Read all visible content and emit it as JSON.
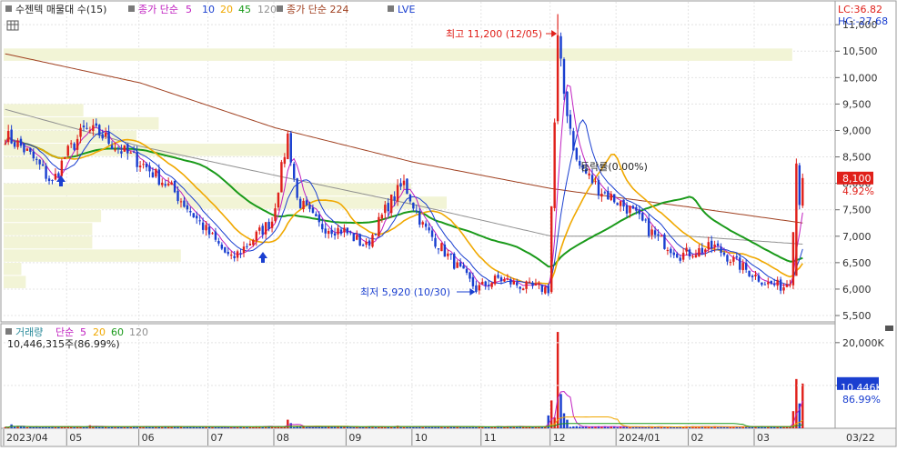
{
  "price_legend": {
    "indicator": "수젠텍 매물대 수(15)",
    "ma_label": "종가 단순",
    "ma_periods": [
      "5",
      "10",
      "20",
      "45",
      "120"
    ],
    "ma224_label": "종가 단순 224",
    "lve_label": "LVE"
  },
  "right_labels": {
    "lc": "LC:36.82",
    "hc": "HC:-27.68",
    "current_price": "8,100",
    "current_pct": "4.92%",
    "current_volume": "10,446K",
    "volume_pct": "86.99%",
    "volume_tick": "20,000K"
  },
  "annotations": {
    "high": "최고 11,200 (12/05)",
    "low": "최저 5,920 (10/30)",
    "rate": "등락률(0.00%)"
  },
  "volume_legend": {
    "title": "거래량",
    "ma_label": "단순",
    "ma_periods": [
      "5",
      "20",
      "60",
      "120"
    ],
    "summary": "10,446,315주(86.99%)"
  },
  "colors": {
    "up": "#e0201a",
    "down": "#1a3fd0",
    "ma5": "#c020c0",
    "ma10": "#1a3fd0",
    "ma20": "#f0a800",
    "ma45": "#1a9a1a",
    "ma120": "#909090",
    "ma224": "#a04020",
    "profile": "#f2f4d6"
  },
  "chart_data": [
    {
      "type": "candlestick",
      "y_ticks": [
        5500,
        6000,
        6500,
        7000,
        7500,
        8000,
        8500,
        9000,
        9500,
        10000,
        10500,
        11000
      ],
      "ylim": [
        5380,
        11450
      ],
      "x_tick_labels": [
        "2023/04",
        "05",
        "06",
        "07",
        "08",
        "09",
        "10",
        "11",
        "12",
        "2024/01",
        "02",
        "03",
        "03/22"
      ],
      "grid": true,
      "anchors": [
        {
          "d": "2023-04-03",
          "p": 8900
        },
        {
          "d": "2023-04-10",
          "p": 8700
        },
        {
          "d": "2023-04-17",
          "p": 8400
        },
        {
          "d": "2023-04-24",
          "p": 8000
        },
        {
          "d": "2023-04-28",
          "p": 8500
        },
        {
          "d": "2023-05-08",
          "p": 9000
        },
        {
          "d": "2023-05-15",
          "p": 8950
        },
        {
          "d": "2023-05-22",
          "p": 8700
        },
        {
          "d": "2023-06-01",
          "p": 8400
        },
        {
          "d": "2023-06-15",
          "p": 7900
        },
        {
          "d": "2023-06-26",
          "p": 7400
        },
        {
          "d": "2023-07-05",
          "p": 6900
        },
        {
          "d": "2023-07-12",
          "p": 6550
        },
        {
          "d": "2023-07-20",
          "p": 6900
        },
        {
          "d": "2023-07-31",
          "p": 7300
        },
        {
          "d": "2023-08-07",
          "p": 8900
        },
        {
          "d": "2023-08-10",
          "p": 7700
        },
        {
          "d": "2023-08-21",
          "p": 7200
        },
        {
          "d": "2023-08-31",
          "p": 7100
        },
        {
          "d": "2023-09-11",
          "p": 6800
        },
        {
          "d": "2023-09-20",
          "p": 7600
        },
        {
          "d": "2023-09-27",
          "p": 8000
        },
        {
          "d": "2023-10-05",
          "p": 7200
        },
        {
          "d": "2023-10-16",
          "p": 6700
        },
        {
          "d": "2023-10-30",
          "p": 6000
        },
        {
          "d": "2023-11-08",
          "p": 6200
        },
        {
          "d": "2023-11-20",
          "p": 6050
        },
        {
          "d": "2023-11-30",
          "p": 6000
        },
        {
          "d": "2023-12-05",
          "p": 10700
        },
        {
          "d": "2023-12-07",
          "p": 9700
        },
        {
          "d": "2023-12-13",
          "p": 8400
        },
        {
          "d": "2023-12-22",
          "p": 7900
        },
        {
          "d": "2024-01-05",
          "p": 7500
        },
        {
          "d": "2024-01-17",
          "p": 7000
        },
        {
          "d": "2024-01-29",
          "p": 6650
        },
        {
          "d": "2024-02-13",
          "p": 6800
        },
        {
          "d": "2024-02-26",
          "p": 6400
        },
        {
          "d": "2024-03-07",
          "p": 6100
        },
        {
          "d": "2024-03-14",
          "p": 6050
        },
        {
          "d": "2024-03-18",
          "p": 6200
        },
        {
          "d": "2024-03-19",
          "p": 7200
        },
        {
          "d": "2024-03-20",
          "p": 8400
        },
        {
          "d": "2024-03-21",
          "p": 7700
        },
        {
          "d": "2024-03-22",
          "p": 8100
        }
      ],
      "high": {
        "date": "2023-12-05",
        "price": 11200
      },
      "low": {
        "date": "2023-10-30",
        "price": 5920
      },
      "last": {
        "date": "2024-03-22",
        "price": 8100,
        "change_pct": 4.92
      },
      "ma224_anchors": [
        {
          "d": "2023-04-03",
          "p": 10450
        },
        {
          "d": "2023-06-01",
          "p": 9900
        },
        {
          "d": "2023-08-01",
          "p": 9050
        },
        {
          "d": "2023-10-01",
          "p": 8400
        },
        {
          "d": "2023-12-01",
          "p": 7900
        },
        {
          "d": "2024-02-01",
          "p": 7550
        },
        {
          "d": "2024-03-22",
          "p": 7250
        }
      ],
      "ma120_anchors": [
        {
          "d": "2023-04-03",
          "p": 9400
        },
        {
          "d": "2023-06-01",
          "p": 8700
        },
        {
          "d": "2023-08-01",
          "p": 8150
        },
        {
          "d": "2023-10-01",
          "p": 7600
        },
        {
          "d": "2023-12-01",
          "p": 7000
        },
        {
          "d": "2024-02-01",
          "p": 7000
        },
        {
          "d": "2024-03-22",
          "p": 6850
        }
      ],
      "volume_profile": [
        {
          "from": 6000,
          "to": 6250,
          "weight": 0.05
        },
        {
          "from": 6250,
          "to": 6500,
          "weight": 0.04
        },
        {
          "from": 6500,
          "to": 6750,
          "weight": 0.4
        },
        {
          "from": 6750,
          "to": 7000,
          "weight": 0.2
        },
        {
          "from": 7000,
          "to": 7250,
          "weight": 0.2
        },
        {
          "from": 7250,
          "to": 7500,
          "weight": 0.22
        },
        {
          "from": 7500,
          "to": 7750,
          "weight": 1.0
        },
        {
          "from": 7750,
          "to": 8000,
          "weight": 0.92
        },
        {
          "from": 8250,
          "to": 8500,
          "weight": 0.1
        },
        {
          "from": 8500,
          "to": 8750,
          "weight": 0.65
        },
        {
          "from": 8750,
          "to": 9000,
          "weight": 0.3
        },
        {
          "from": 9000,
          "to": 9250,
          "weight": 0.35
        },
        {
          "from": 9250,
          "to": 9500,
          "weight": 0.18
        },
        {
          "from": 10300,
          "to": 10550,
          "weight": 1.78
        }
      ]
    },
    {
      "type": "bar",
      "series_name": "거래량",
      "unit": "주",
      "y_ticks": [
        10000,
        20000
      ],
      "ylim": [
        0,
        24000
      ],
      "last_volume": 10446315,
      "last_volume_pct": 86.99,
      "spikes": [
        {
          "d": "2023-04-05",
          "v": 900
        },
        {
          "d": "2023-05-10",
          "v": 700
        },
        {
          "d": "2023-08-07",
          "v": 2000
        },
        {
          "d": "2023-08-08",
          "v": 1200
        },
        {
          "d": "2023-09-25",
          "v": 600
        },
        {
          "d": "2023-11-30",
          "v": 3000
        },
        {
          "d": "2023-12-01",
          "v": 6500
        },
        {
          "d": "2023-12-04",
          "v": 2500
        },
        {
          "d": "2023-12-05",
          "v": 22500
        },
        {
          "d": "2023-12-06",
          "v": 8000
        },
        {
          "d": "2023-12-07",
          "v": 3500
        },
        {
          "d": "2023-12-08",
          "v": 2000
        },
        {
          "d": "2024-03-19",
          "v": 4000
        },
        {
          "d": "2024-03-20",
          "v": 11500
        },
        {
          "d": "2024-03-21",
          "v": 5800
        },
        {
          "d": "2024-03-22",
          "v": 10446
        }
      ],
      "baseline": 350
    }
  ]
}
